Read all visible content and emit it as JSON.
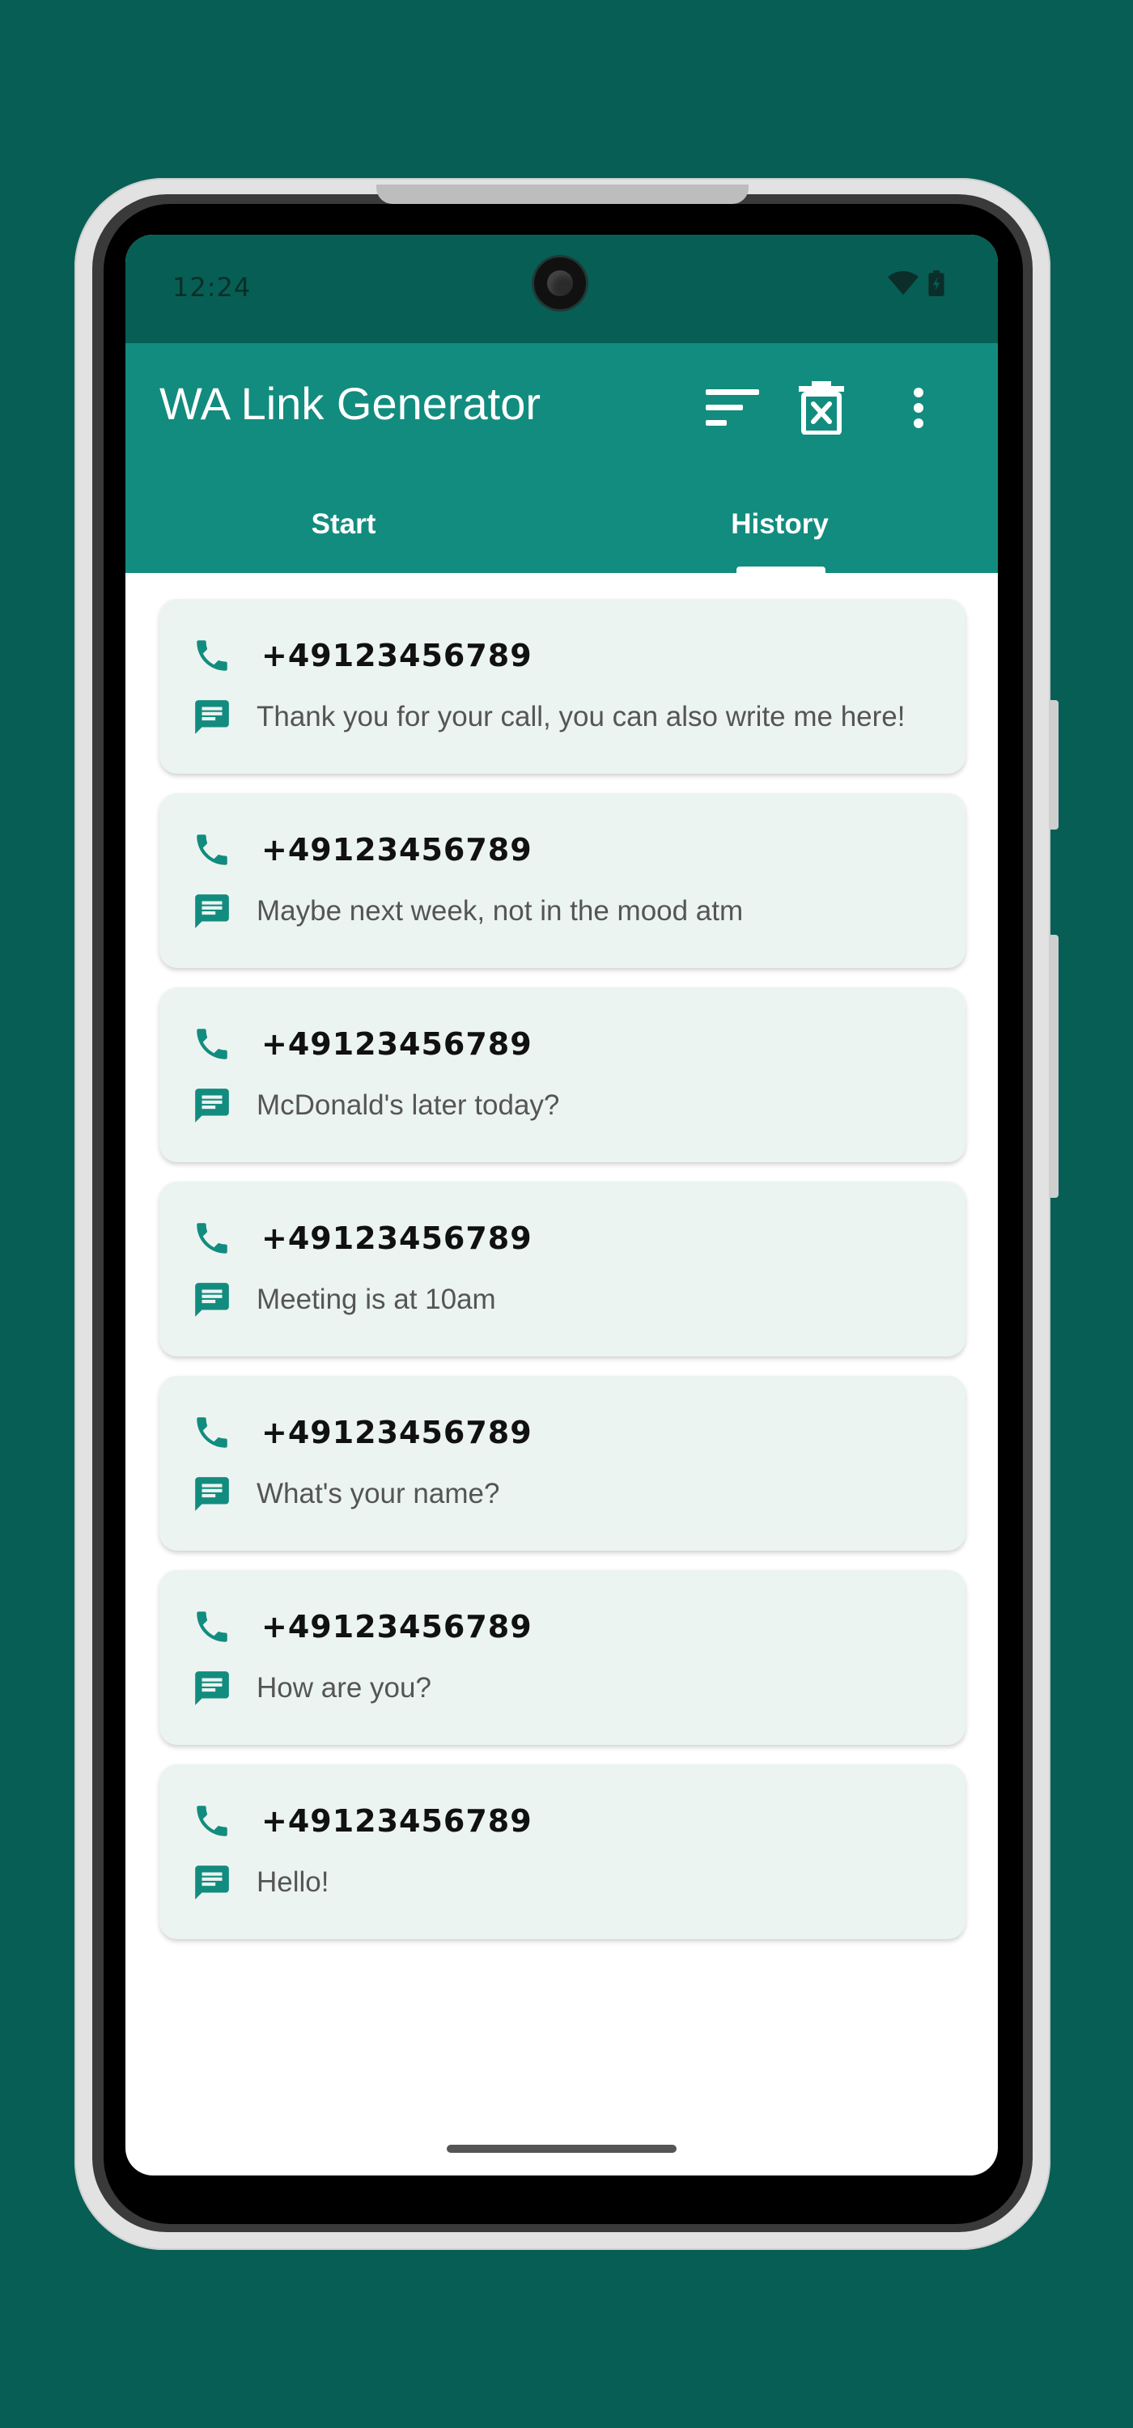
{
  "status_bar": {
    "time": "12:24",
    "icons": [
      "wifi-icon",
      "battery-icon"
    ]
  },
  "app_bar": {
    "title": "WA Link Generator",
    "actions": [
      "sort-icon",
      "clear-history-icon",
      "more-vert-icon"
    ]
  },
  "tabs": [
    {
      "label": "Start",
      "selected": false
    },
    {
      "label": "History",
      "selected": true
    }
  ],
  "history": [
    {
      "phone": "+49123456789",
      "message": "Thank you for your call, you can also write me here!"
    },
    {
      "phone": "+49123456789",
      "message": "Maybe next week, not in the mood atm"
    },
    {
      "phone": "+49123456789",
      "message": "McDonald's later today?"
    },
    {
      "phone": "+49123456789",
      "message": "Meeting is at 10am"
    },
    {
      "phone": "+49123456789",
      "message": "What's your name?"
    },
    {
      "phone": "+49123456789",
      "message": "How are you?"
    },
    {
      "phone": "+49123456789",
      "message": "Hello!"
    }
  ],
  "colors": {
    "background": "#075E54",
    "app_bar": "#128C7E",
    "card": "#ECF4F2",
    "icon_accent": "#128C7E"
  }
}
